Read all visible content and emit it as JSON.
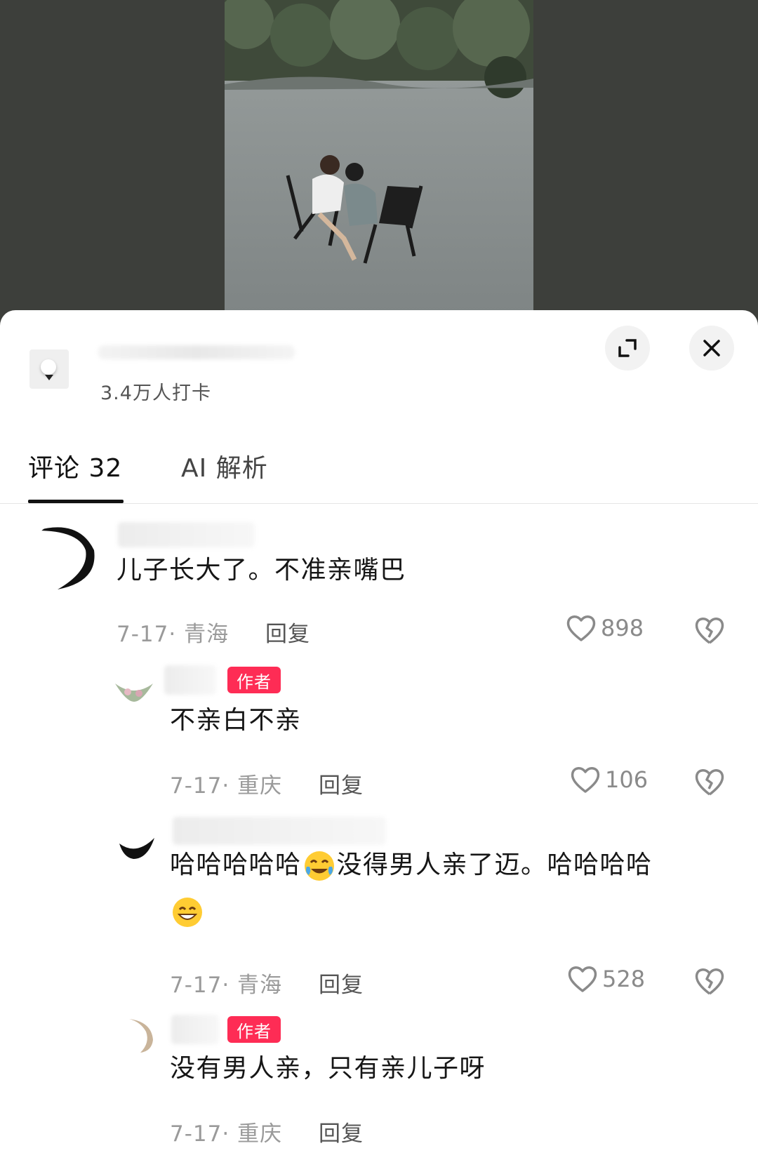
{
  "location": {
    "checkins": "3.4万人打卡"
  },
  "tabs": [
    {
      "label": "评论 32"
    },
    {
      "label": "AI 解析"
    }
  ],
  "comments": [
    {
      "text": "儿子长大了。不准亲嘴巴",
      "date_region": "7-17· 青海",
      "reply_label": "回复",
      "likes": "898"
    },
    {
      "author_badge": "作者",
      "text": "不亲白不亲",
      "date_region": "7-17· 重庆",
      "reply_label": "回复",
      "likes": "106"
    },
    {
      "text_part1": "哈哈哈哈哈",
      "text_part2": "没得男人亲了迈。哈哈哈哈",
      "emoji1": "tears-of-joy-emoji",
      "emoji2": "grinning-emoji",
      "date_region": "7-17· 青海",
      "reply_label": "回复",
      "likes": "528"
    },
    {
      "author_badge": "作者",
      "text": "没有男人亲，只有亲儿子呀",
      "date_region": "7-17· 重庆",
      "reply_label": "回复"
    }
  ],
  "colors": {
    "author_badge": "#fe2c55",
    "background_dark": "#3d3f3b"
  }
}
